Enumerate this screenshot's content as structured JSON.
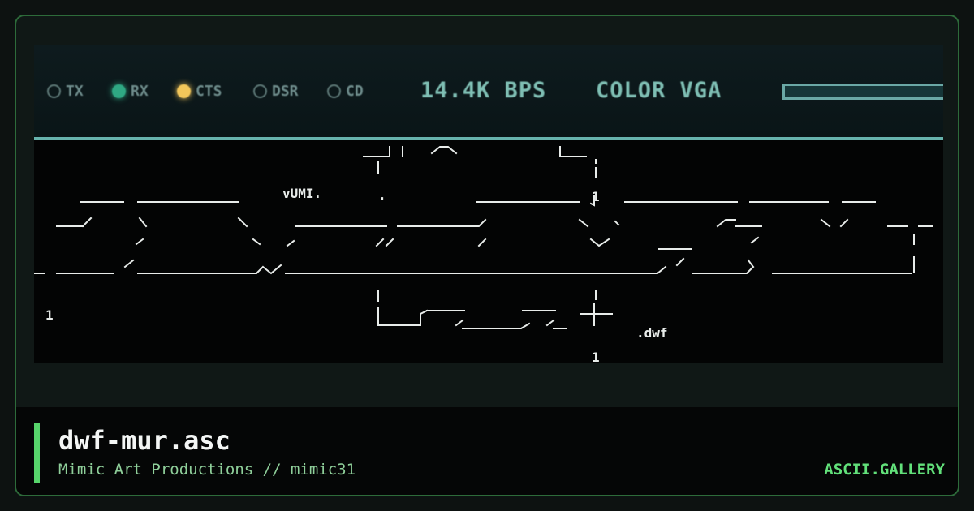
{
  "screen": {
    "status_lights": [
      {
        "label": "TX",
        "state": "off",
        "color": "#5d7876"
      },
      {
        "label": "RX",
        "state": "on",
        "color": "#2fa883"
      },
      {
        "label": "CTS",
        "state": "on",
        "color": "#f2c65a"
      },
      {
        "label": "DSR",
        "state": "off",
        "color": "#5d7876"
      },
      {
        "label": "CD",
        "state": "off",
        "color": "#5d7876"
      }
    ],
    "baud_rate": "14.4K BPS",
    "display_mode": "COLOR VGA",
    "art_labels": {
      "text1": "vUMI.",
      "text2": ".dwf",
      "mark1": "1",
      "mark2": "1",
      "mark3": "1"
    }
  },
  "footer": {
    "title": "dwf-mur.asc",
    "subtitle": "Mimic Art Productions // mimic31",
    "brand": "ASCII.GALLERY"
  },
  "colors": {
    "accent": "#57d46b",
    "brand": "#62e07a",
    "screen_bg": "#030404",
    "status_text": "#7fbfb4"
  }
}
